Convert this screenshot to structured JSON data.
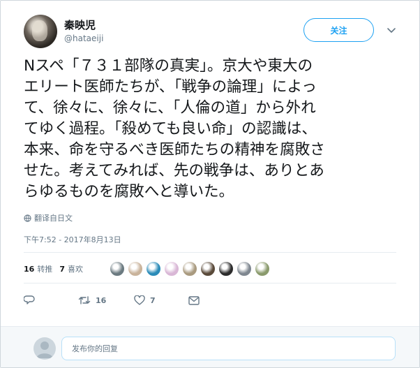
{
  "user": {
    "display_name": "秦映児",
    "handle": "@hataeiji"
  },
  "follow_button": {
    "label": "关注"
  },
  "tweet": {
    "text_lines": [
      "Nスペ「７３１部隊の真実」。京大や東大の",
      "エリート医師たちが、「戦争の論理」によっ",
      "て、徐々に、徐々に、「人倫の道」から外れ",
      "てゆく過程。「殺めても良い命」の認識は、",
      "本来、命を守るべき医師たちの精神を腐敗さ",
      "せた。考えてみれば、先の戦争は、ありとあ",
      "らゆるものを腐敗へと導いた。"
    ],
    "translate_label": "翻译自日文",
    "timestamp": "下午7:52 - 2017年8月13日"
  },
  "stats": {
    "retweets_count": "16",
    "retweets_label": "转推",
    "likes_count": "7",
    "likes_label": "喜欢"
  },
  "liker_avatars": [
    {
      "color": "#6b7a80"
    },
    {
      "color": "#c9b39b"
    },
    {
      "color": "#2a8bb8"
    },
    {
      "color": "#d9b7d6"
    },
    {
      "color": "#a99a7f"
    },
    {
      "color": "#5a4a3a"
    },
    {
      "color": "#2c2c2c"
    },
    {
      "color": "#7f8790"
    },
    {
      "color": "#8a9a6c"
    }
  ],
  "actions": {
    "reply_count": "",
    "retweet_count": "16",
    "like_count": "7"
  },
  "reply": {
    "placeholder": "发布你的回复"
  },
  "colors": {
    "accent": "#1da1f2",
    "secondary_text": "#657786"
  }
}
